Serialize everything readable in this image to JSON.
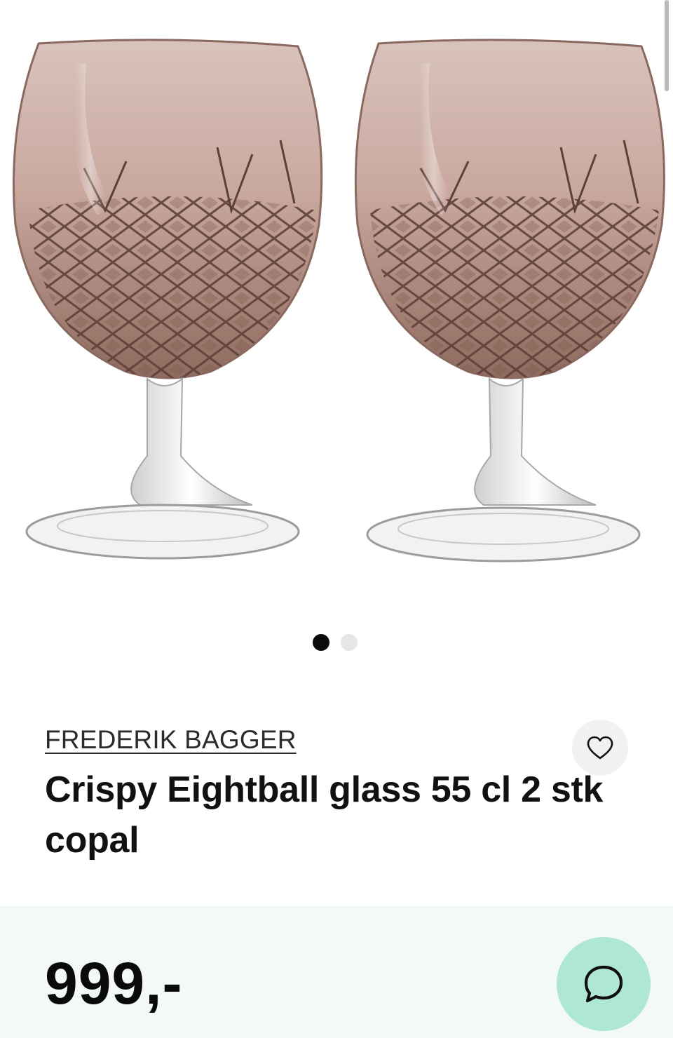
{
  "product": {
    "brand": "FREDERIK BAGGER",
    "title": "Crispy Eightball glass 55 cl 2 stk copal",
    "price": "999,-"
  },
  "gallery": {
    "image_count": 2,
    "active_index": 0,
    "image_icon": "glass-pair-image"
  },
  "icons": {
    "favorite": "heart-icon",
    "chat": "chat-bubble-icon"
  },
  "colors": {
    "price_bar_bg": "#f2f9f6",
    "chat_button_bg": "#aee8d2",
    "glass_tint": "#a8857a"
  }
}
